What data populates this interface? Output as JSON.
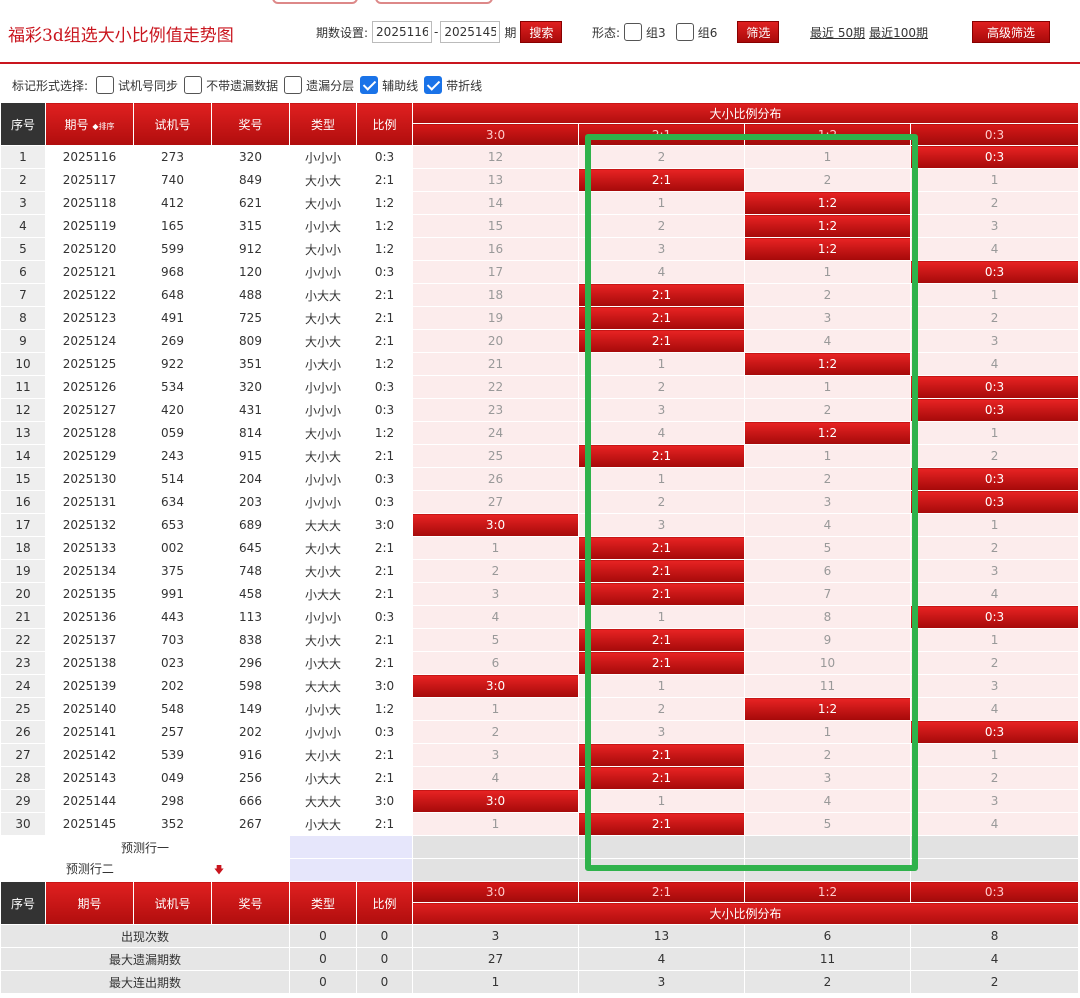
{
  "header": {
    "title": "福彩3d组选大小比例值走势图",
    "period_label": "期数设置:",
    "period_from": "2025116",
    "period_to": "2025145",
    "period_unit": "期",
    "dash": "-",
    "search_label": "搜索",
    "form_label": "形态:",
    "group3_label": "组3",
    "group6_label": "组6",
    "filter_label": "筛选",
    "recent50_label": "最近 50期",
    "recent100_label": "最近100期",
    "advanced_label": "高级筛选"
  },
  "options": {
    "label": "标记形式选择:",
    "items": [
      {
        "label": "试机号同步",
        "checked": false
      },
      {
        "label": "不带遗漏数据",
        "checked": false
      },
      {
        "label": "遗漏分层",
        "checked": false
      },
      {
        "label": "辅助线",
        "checked": true
      },
      {
        "label": "带折线",
        "checked": true
      }
    ]
  },
  "table": {
    "headers": {
      "seq": "序号",
      "period": "期号",
      "sort": "排序",
      "trial": "试机号",
      "winning": "奖号",
      "type": "类型",
      "ratio": "比例",
      "distribution": "大小比例分布",
      "ratio_cols": [
        "3:0",
        "2:1",
        "1:2",
        "0:3"
      ]
    },
    "rows": [
      {
        "seq": "1",
        "period": "2025116",
        "trial": "273",
        "winning": "320",
        "type": "小小小",
        "ratio": "0:3",
        "hit": 3,
        "miss": [
          "12",
          "2",
          "1"
        ]
      },
      {
        "seq": "2",
        "period": "2025117",
        "trial": "740",
        "winning": "849",
        "type": "大小大",
        "ratio": "2:1",
        "hit": 1,
        "miss": [
          "13",
          "2",
          "1"
        ]
      },
      {
        "seq": "3",
        "period": "2025118",
        "trial": "412",
        "winning": "621",
        "type": "大小小",
        "ratio": "1:2",
        "hit": 2,
        "miss": [
          "14",
          "1",
          "2"
        ]
      },
      {
        "seq": "4",
        "period": "2025119",
        "trial": "165",
        "winning": "315",
        "type": "小小大",
        "ratio": "1:2",
        "hit": 2,
        "miss": [
          "15",
          "2",
          "3"
        ]
      },
      {
        "seq": "5",
        "period": "2025120",
        "trial": "599",
        "winning": "912",
        "type": "大小小",
        "ratio": "1:2",
        "hit": 2,
        "miss": [
          "16",
          "3",
          "4"
        ]
      },
      {
        "seq": "6",
        "period": "2025121",
        "trial": "968",
        "winning": "120",
        "type": "小小小",
        "ratio": "0:3",
        "hit": 3,
        "miss": [
          "17",
          "4",
          "1"
        ]
      },
      {
        "seq": "7",
        "period": "2025122",
        "trial": "648",
        "winning": "488",
        "type": "小大大",
        "ratio": "2:1",
        "hit": 1,
        "miss": [
          "18",
          "2",
          "1"
        ]
      },
      {
        "seq": "8",
        "period": "2025123",
        "trial": "491",
        "winning": "725",
        "type": "大小大",
        "ratio": "2:1",
        "hit": 1,
        "miss": [
          "19",
          "3",
          "2"
        ]
      },
      {
        "seq": "9",
        "period": "2025124",
        "trial": "269",
        "winning": "809",
        "type": "大小大",
        "ratio": "2:1",
        "hit": 1,
        "miss": [
          "20",
          "4",
          "3"
        ]
      },
      {
        "seq": "10",
        "period": "2025125",
        "trial": "922",
        "winning": "351",
        "type": "小大小",
        "ratio": "1:2",
        "hit": 2,
        "miss": [
          "21",
          "1",
          "4"
        ]
      },
      {
        "seq": "11",
        "period": "2025126",
        "trial": "534",
        "winning": "320",
        "type": "小小小",
        "ratio": "0:3",
        "hit": 3,
        "miss": [
          "22",
          "2",
          "1"
        ]
      },
      {
        "seq": "12",
        "period": "2025127",
        "trial": "420",
        "winning": "431",
        "type": "小小小",
        "ratio": "0:3",
        "hit": 3,
        "miss": [
          "23",
          "3",
          "2"
        ]
      },
      {
        "seq": "13",
        "period": "2025128",
        "trial": "059",
        "winning": "814",
        "type": "大小小",
        "ratio": "1:2",
        "hit": 2,
        "miss": [
          "24",
          "4",
          "1"
        ]
      },
      {
        "seq": "14",
        "period": "2025129",
        "trial": "243",
        "winning": "915",
        "type": "大小大",
        "ratio": "2:1",
        "hit": 1,
        "miss": [
          "25",
          "1",
          "2"
        ]
      },
      {
        "seq": "15",
        "period": "2025130",
        "trial": "514",
        "winning": "204",
        "type": "小小小",
        "ratio": "0:3",
        "hit": 3,
        "miss": [
          "26",
          "1",
          "2"
        ]
      },
      {
        "seq": "16",
        "period": "2025131",
        "trial": "634",
        "winning": "203",
        "type": "小小小",
        "ratio": "0:3",
        "hit": 3,
        "miss": [
          "27",
          "2",
          "3"
        ]
      },
      {
        "seq": "17",
        "period": "2025132",
        "trial": "653",
        "winning": "689",
        "type": "大大大",
        "ratio": "3:0",
        "hit": 0,
        "miss": [
          "3",
          "4",
          "1"
        ]
      },
      {
        "seq": "18",
        "period": "2025133",
        "trial": "002",
        "winning": "645",
        "type": "大小大",
        "ratio": "2:1",
        "hit": 1,
        "miss": [
          "1",
          "5",
          "2"
        ]
      },
      {
        "seq": "19",
        "period": "2025134",
        "trial": "375",
        "winning": "748",
        "type": "大小大",
        "ratio": "2:1",
        "hit": 1,
        "miss": [
          "2",
          "6",
          "3"
        ]
      },
      {
        "seq": "20",
        "period": "2025135",
        "trial": "991",
        "winning": "458",
        "type": "小大大",
        "ratio": "2:1",
        "hit": 1,
        "miss": [
          "3",
          "7",
          "4"
        ]
      },
      {
        "seq": "21",
        "period": "2025136",
        "trial": "443",
        "winning": "113",
        "type": "小小小",
        "ratio": "0:3",
        "hit": 3,
        "miss": [
          "4",
          "1",
          "8"
        ]
      },
      {
        "seq": "22",
        "period": "2025137",
        "trial": "703",
        "winning": "838",
        "type": "大小大",
        "ratio": "2:1",
        "hit": 1,
        "miss": [
          "5",
          "9",
          "1"
        ]
      },
      {
        "seq": "23",
        "period": "2025138",
        "trial": "023",
        "winning": "296",
        "type": "小大大",
        "ratio": "2:1",
        "hit": 1,
        "miss": [
          "6",
          "10",
          "2"
        ]
      },
      {
        "seq": "24",
        "period": "2025139",
        "trial": "202",
        "winning": "598",
        "type": "大大大",
        "ratio": "3:0",
        "hit": 0,
        "miss": [
          "1",
          "11",
          "3"
        ]
      },
      {
        "seq": "25",
        "period": "2025140",
        "trial": "548",
        "winning": "149",
        "type": "小小大",
        "ratio": "1:2",
        "hit": 2,
        "miss": [
          "1",
          "2",
          "4"
        ]
      },
      {
        "seq": "26",
        "period": "2025141",
        "trial": "257",
        "winning": "202",
        "type": "小小小",
        "ratio": "0:3",
        "hit": 3,
        "miss": [
          "2",
          "3",
          "1"
        ]
      },
      {
        "seq": "27",
        "period": "2025142",
        "trial": "539",
        "winning": "916",
        "type": "大小大",
        "ratio": "2:1",
        "hit": 1,
        "miss": [
          "3",
          "2",
          "1"
        ]
      },
      {
        "seq": "28",
        "period": "2025143",
        "trial": "049",
        "winning": "256",
        "type": "小大大",
        "ratio": "2:1",
        "hit": 1,
        "miss": [
          "4",
          "3",
          "2"
        ]
      },
      {
        "seq": "29",
        "period": "2025144",
        "trial": "298",
        "winning": "666",
        "type": "大大大",
        "ratio": "3:0",
        "hit": 0,
        "miss": [
          "1",
          "4",
          "3"
        ]
      },
      {
        "seq": "30",
        "period": "2025145",
        "trial": "352",
        "winning": "267",
        "type": "小大大",
        "ratio": "2:1",
        "hit": 1,
        "miss": [
          "1",
          "5",
          "4"
        ]
      }
    ],
    "prediction_rows": [
      "预测行一",
      "预测行二"
    ],
    "stats": [
      {
        "label": "出现次数",
        "type": "0",
        "ratio": "0",
        "values": [
          "3",
          "13",
          "6",
          "8"
        ]
      },
      {
        "label": "最大遗漏期数",
        "type": "0",
        "ratio": "0",
        "values": [
          "27",
          "4",
          "11",
          "4"
        ]
      },
      {
        "label": "最大连出期数",
        "type": "0",
        "ratio": "0",
        "values": [
          "1",
          "3",
          "2",
          "2"
        ]
      }
    ]
  },
  "colors": {
    "brand_red": "#c9151e",
    "hit_red": "#d11414",
    "miss_pink": "#fcecec",
    "highlight_green": "#2fb24b",
    "header_dark": "#333333"
  }
}
